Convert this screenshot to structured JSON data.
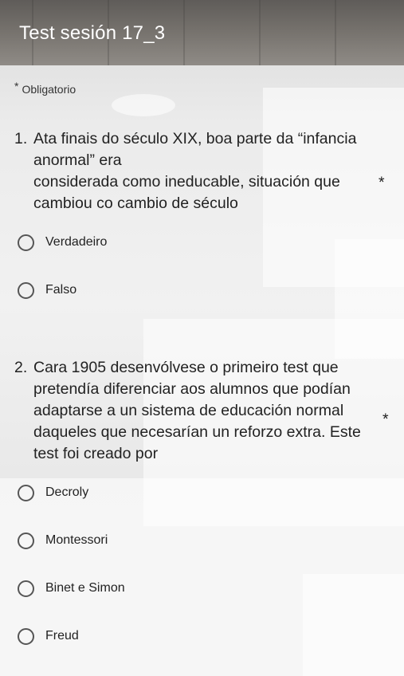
{
  "form": {
    "title": "Test sesión 17_3",
    "required_note": "Obligatorio",
    "required_marker": "*"
  },
  "questions": [
    {
      "number": "1.",
      "lines": [
        "Ata finais do século XIX, boa parte da “infancia",
        "anormal” era",
        "considerada como ineducable, situación que",
        "cambiou co cambio de século"
      ],
      "required_marker": "*",
      "options": [
        "Verdadeiro",
        "Falso"
      ]
    },
    {
      "number": "2.",
      "lines": [
        "Cara 1905 desenvólvese o primeiro test que",
        "pretendía diferenciar aos alumnos que podían",
        "adaptarse a un sistema de educación normal",
        "daqueles que necesarían un reforzo extra. Este",
        "test foi creado por"
      ],
      "required_marker": "*",
      "options": [
        "Decroly",
        "Montessori",
        "Binet e Simon",
        "Freud"
      ]
    }
  ]
}
